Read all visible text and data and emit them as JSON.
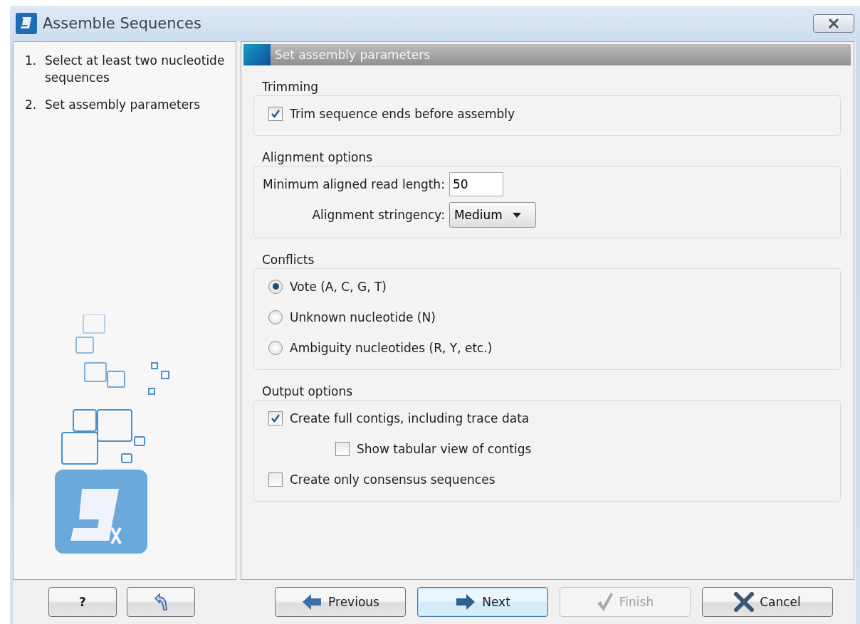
{
  "window": {
    "title": "Assemble Sequences"
  },
  "steps": [
    {
      "number": "1.",
      "label": "Select at least two nucleotide sequences"
    },
    {
      "number": "2.",
      "label": "Set assembly parameters"
    }
  ],
  "header": "Set assembly parameters",
  "sections": [
    {
      "title": "Trimming",
      "items": [
        {
          "kind": "checkbox",
          "label": "Trim sequence ends before assembly",
          "checked": true
        }
      ]
    },
    {
      "title": "Alignment options",
      "items": [
        {
          "kind": "field",
          "label": "Minimum aligned read length:",
          "value": "50"
        },
        {
          "kind": "dropdown",
          "label": "Alignment stringency:",
          "value": "Medium"
        }
      ]
    },
    {
      "title": "Conflicts",
      "items": [
        {
          "kind": "radio",
          "label": "Vote (A, C, G, T)",
          "selected": true
        },
        {
          "kind": "radio",
          "label": "Unknown nucleotide (N)",
          "selected": false
        },
        {
          "kind": "radio",
          "label": "Ambiguity nucleotides (R, Y, etc.)",
          "selected": false
        }
      ]
    },
    {
      "title": "Output options",
      "items": [
        {
          "kind": "checkbox",
          "label": "Create full contigs, including trace data",
          "checked": true,
          "children": [
            {
              "kind": "checkbox",
              "label": "Show tabular view of contigs",
              "checked": false
            }
          ]
        },
        {
          "kind": "checkbox",
          "label": "Create only consensus sequences",
          "checked": false
        }
      ]
    }
  ],
  "left_buttons": [
    {
      "kind": "help",
      "label": "?"
    },
    {
      "kind": "restore"
    }
  ],
  "buttons": [
    {
      "kind": "previous",
      "label": "Previous",
      "disabled": false,
      "focused": false
    },
    {
      "kind": "next",
      "label": "Next",
      "disabled": false,
      "focused": true
    },
    {
      "kind": "finish",
      "label": "Finish",
      "disabled": true,
      "focused": false
    },
    {
      "kind": "cancel",
      "label": "Cancel",
      "disabled": false,
      "focused": false
    }
  ]
}
